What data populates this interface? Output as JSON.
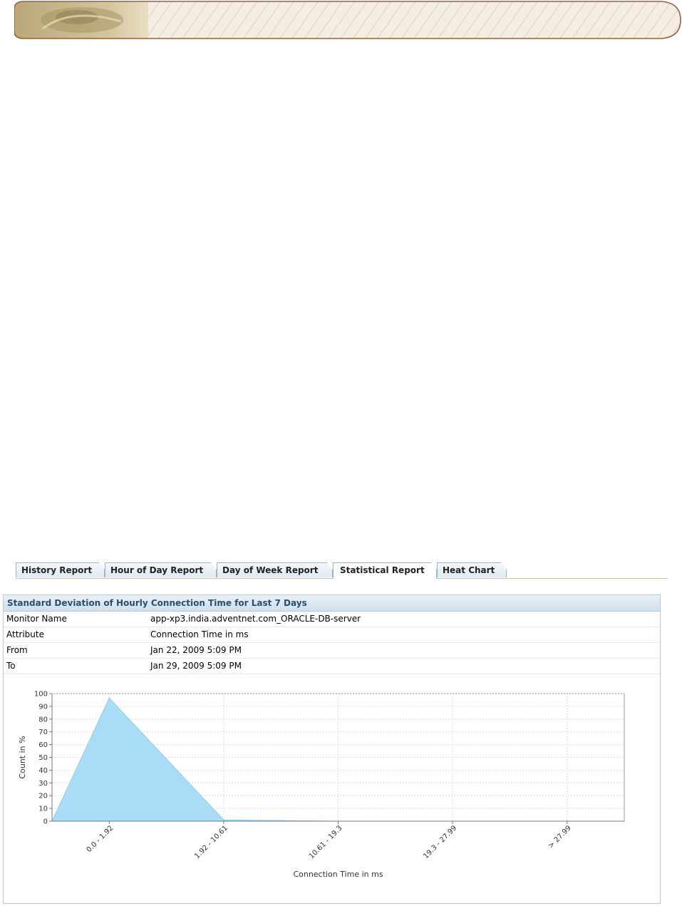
{
  "tabs": [
    {
      "label": "History Report",
      "active": false
    },
    {
      "label": "Hour of Day Report",
      "active": false
    },
    {
      "label": "Day of Week Report",
      "active": false
    },
    {
      "label": "Statistical Report",
      "active": true
    },
    {
      "label": "Heat Chart",
      "active": false
    }
  ],
  "report": {
    "title": "Standard Deviation of Hourly Connection Time for Last 7 Days",
    "rows": [
      {
        "label": "Monitor Name",
        "value": "app-xp3.india.adventnet.com_ORACLE-DB-server"
      },
      {
        "label": "Attribute",
        "value": "Connection Time in ms"
      },
      {
        "label": "From",
        "value": "Jan 22, 2009 5:09 PM"
      },
      {
        "label": "To",
        "value": "Jan 29, 2009 5:09 PM"
      }
    ]
  },
  "colors": {
    "area_fill": "#a8dcf7",
    "area_stroke": "#8fcdee",
    "tab_border": "#9ab6c9",
    "title_text": "#2b4e6c"
  },
  "chart_data": {
    "type": "area",
    "categories": [
      "0.0 - 1.92",
      "1.92 - 10.61",
      "10.61 - 19.3",
      "19.3 - 27.99",
      "> 27.99"
    ],
    "series": [
      {
        "values": [
          96.5,
          1,
          0,
          0,
          0
        ]
      }
    ],
    "start_value": 0,
    "xlabel": "Connection Time in ms",
    "ylabel": "Count in %",
    "ylim": [
      0,
      100
    ],
    "yticks": [
      0,
      10,
      20,
      30,
      40,
      50,
      60,
      70,
      80,
      90,
      100
    ],
    "grid": true,
    "legend": "none"
  }
}
